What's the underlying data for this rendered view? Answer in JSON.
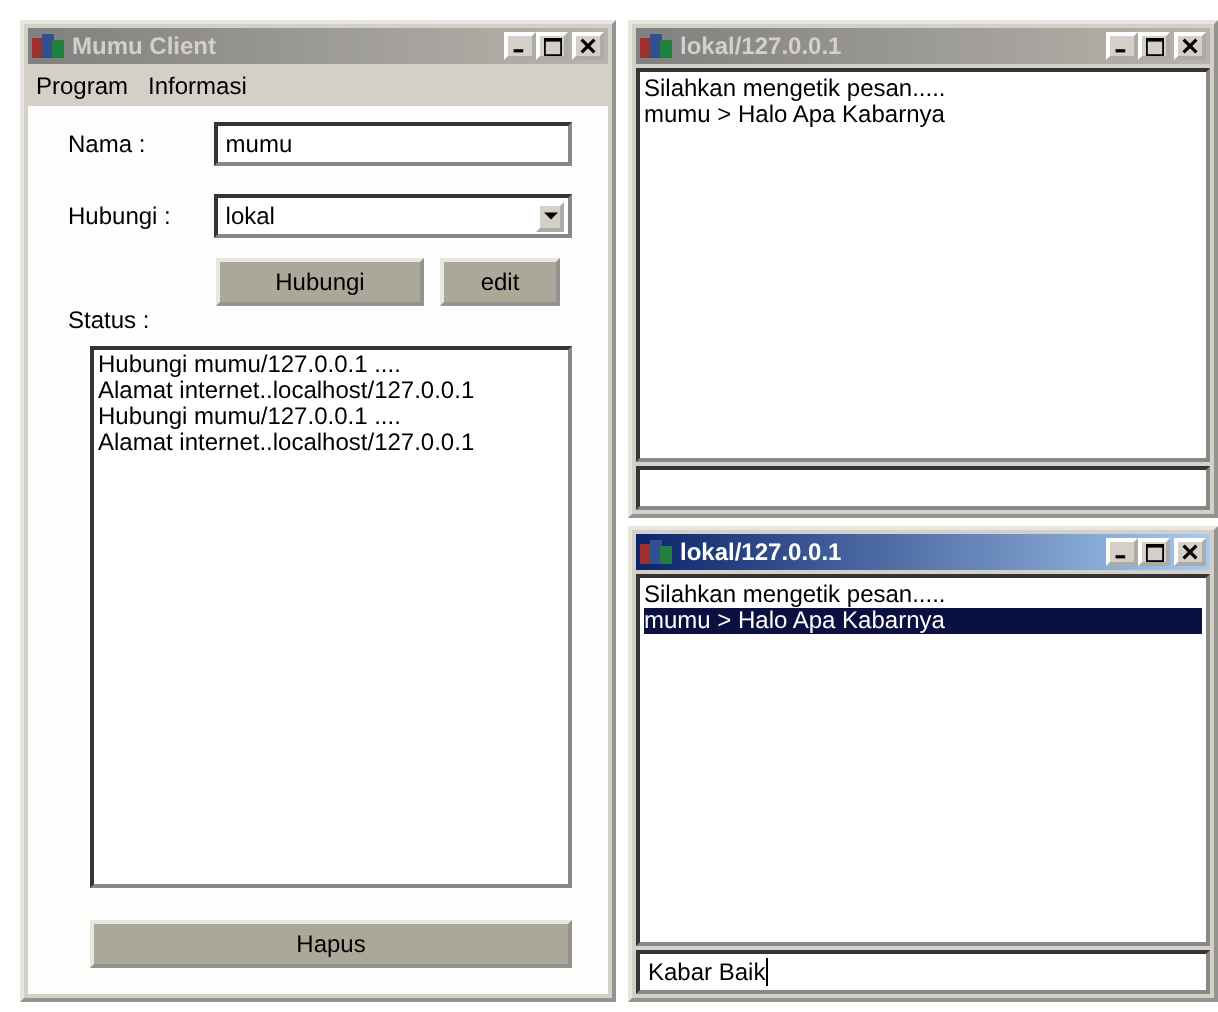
{
  "client": {
    "title": "Mumu Client",
    "active": false,
    "menu": [
      "Program",
      "Informasi"
    ],
    "name_label": "Nama   :",
    "name_value": "mumu",
    "connect_label": "Hubungi :",
    "connect_value": "lokal",
    "buttons": [
      "Hubungi",
      "edit"
    ],
    "status_label": "Status :",
    "status_lines": [
      "Hubungi mumu/127.0.0.1 ....",
      "Alamat internet..localhost/127.0.0.1",
      "Hubungi mumu/127.0.0.1 ....",
      "Alamat internet..localhost/127.0.0.1"
    ],
    "clear_button": "Hapus"
  },
  "chats": [
    {
      "title": "lokal/127.0.0.1",
      "active": false,
      "messages": [
        {
          "text": "Silahkan mengetik pesan.....",
          "selected": false
        },
        {
          "text": "mumu > Halo Apa Kabarnya",
          "selected": false
        }
      ]
    },
    {
      "title": "lokal/127.0.0.1",
      "active": true,
      "messages": [
        {
          "text": "Silahkan mengetik pesan.....",
          "selected": false
        },
        {
          "text": "mumu > Halo Apa Kabarnya",
          "selected": true
        }
      ],
      "input": "Kabar Baik"
    }
  ]
}
